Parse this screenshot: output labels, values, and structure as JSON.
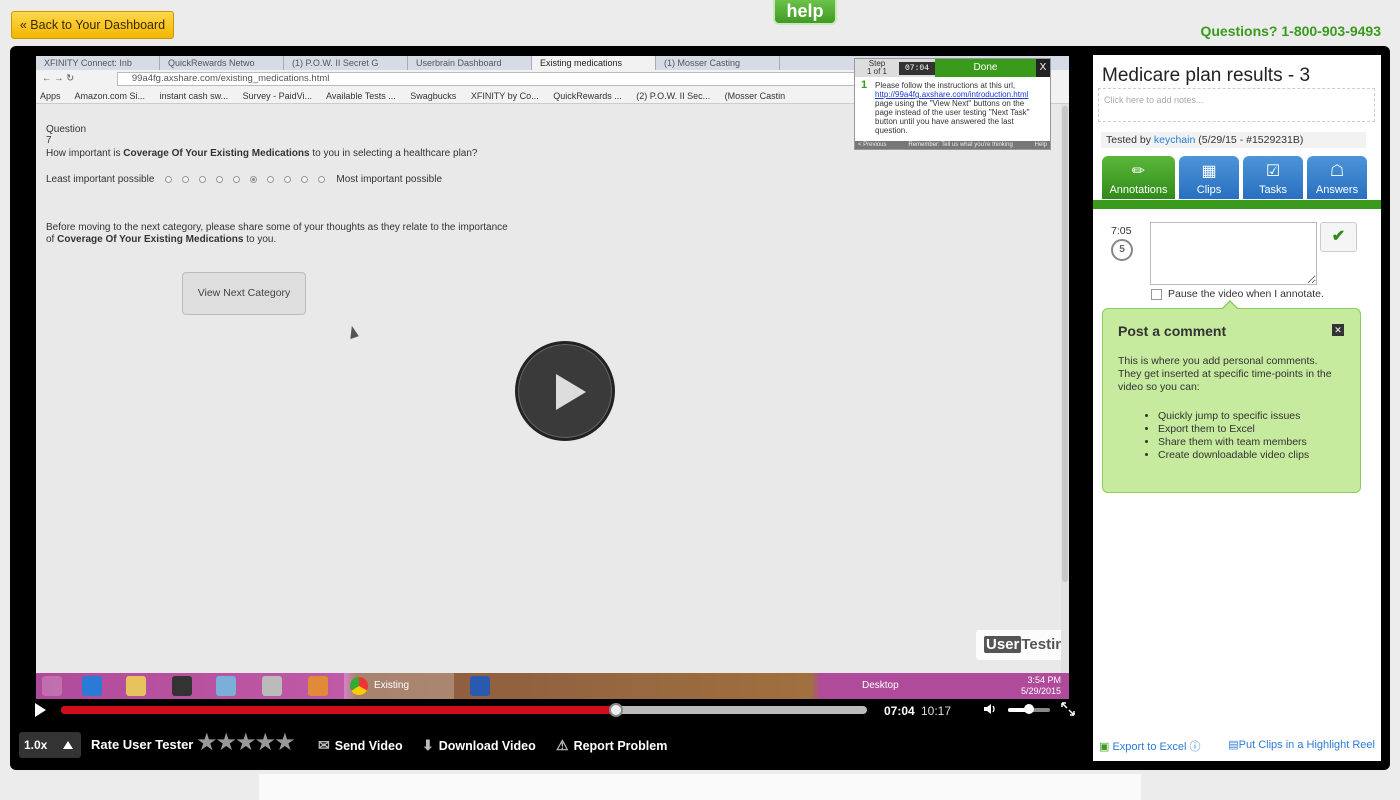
{
  "header": {
    "back_label": "« Back to Your Dashboard",
    "help_label": "help",
    "phone_label": "Questions? 1-800-903-9493"
  },
  "browser": {
    "tabs": [
      "XFINITY Connect: Inb",
      "QuickRewards Netwo",
      "(1) P.O.W. II Secret G",
      "Userbrain Dashboard",
      "Existing medications",
      "(1) Mosser Casting"
    ],
    "active_tab_index": 4,
    "url": "99a4fg.axshare.com/existing_medications.html",
    "bookmarks": [
      "Apps",
      "Amazon.com Si...",
      "instant cash sw...",
      "Survey - PaidVi...",
      "Available Tests ...",
      "Swagbucks",
      "XFINITY by Co...",
      "QuickRewards ...",
      "(2) P.O.W. II Sec...",
      "(Mosser Castin"
    ]
  },
  "page": {
    "question_label": "Question 7",
    "question_pre": "How important is ",
    "question_bold": "Coverage Of Your Existing Medications",
    "question_post": " to you in selecting a healthcare plan?",
    "scale_min": "Least important possible",
    "scale_max": "Most important possible",
    "scale_count": 10,
    "scale_selected": 6,
    "thoughts_pre": "Before moving to the next category, please share some of your thoughts as they relate to the importance of ",
    "thoughts_bold": "Coverage Of Your Existing Medications",
    "thoughts_post": " to you.",
    "next_button": "View Next Category"
  },
  "step_panel": {
    "step_label": "Step",
    "step_count": "1 of 1",
    "timer": "07:04",
    "done_label": "Done",
    "close": "X",
    "number": "1",
    "text_1": "Please follow the instructions at this url, ",
    "link": "http://99a4fg.axshare.com/introduction.html",
    "text_2": " page using the \"View Next\" buttons on the page instead of the user testing \"Next Task\" button until you have answered the last question.",
    "footer_prev": "< Previous",
    "footer_remember": "Remember: Tell us what you're thinking",
    "footer_help": "Help"
  },
  "watermark": {
    "box": "User",
    "rest": "Testing"
  },
  "taskbar": {
    "chrome_label": "Existing medicati...",
    "desktop_label": "Desktop",
    "time": "3:54 PM",
    "date": "5/29/2015"
  },
  "player": {
    "current_time": "07:04",
    "total_time": "10:17",
    "progress": 0.6884,
    "volume": 0.5,
    "speed": "1.0x",
    "rate_label": "Rate User Tester",
    "stars": "★★★★★",
    "send_label": "Send Video",
    "download_label": "Download Video",
    "report_label": "Report Problem"
  },
  "panel": {
    "title": "Medicare plan results - 3",
    "notes_placeholder": "Click here to add notes...",
    "tested_by": "Tested by ",
    "user": "keychain",
    "tested_meta": " (5/29/15 - #1529231B)",
    "tabs": [
      {
        "label": "Annotations",
        "icon": "pencil-icon"
      },
      {
        "label": "Clips",
        "icon": "film-icon"
      },
      {
        "label": "Tasks",
        "icon": "clipboard-icon"
      },
      {
        "label": "Answers",
        "icon": "chat-icon"
      }
    ],
    "annot_time": "7:05",
    "replay_seconds": "5",
    "pause_label": "Pause the video when I annotate.",
    "comment_title": "Post a comment",
    "comment_desc": "This is where you add personal comments. They get inserted at specific time-points in the video so you can:",
    "comment_items": [
      "Quickly jump to specific issues",
      "Export them to Excel",
      "Share them with team members",
      "Create downloadable video clips"
    ],
    "export_label": "Export to Excel",
    "reel_label": "Put Clips in a Highlight Reel"
  }
}
